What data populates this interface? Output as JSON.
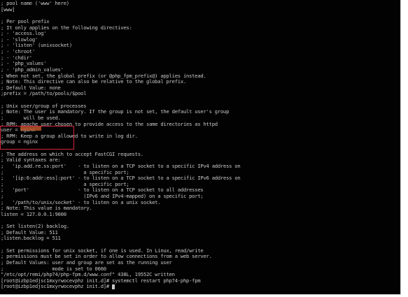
{
  "terminal": {
    "lines": [
      "; pool name ('www' here)",
      "[www]",
      "",
      "; Per pool prefix",
      "; It only applies on the following directives:",
      "; - 'access.log'",
      "; - 'slowlog'",
      "; - 'listen' (unixsocket)",
      "; - 'chroot'",
      "; - 'chdir'",
      "; - 'php_values'",
      "; - 'php_admin_values'",
      "; When not set, the global prefix (or @php_fpm_prefix@) applies instead.",
      "; Note: This directive can also be relative to the global prefix.",
      "; Default Value: none",
      ";prefix = /path/to/pools/$pool",
      "",
      "; Unix user/group of processes",
      "; Note: The user is mandatory. If the group is not set, the default user's group",
      ";       will be used.",
      "; RPM: apache user chosen to provide access to the same directories as httpd",
      "user = nginx",
      "; RPM: Keep a group allowed to write in log dir.",
      "group = nginx",
      "",
      "; The address on which to accept FastCGI requests.",
      "; Valid syntaxes are:",
      ";   'ip.add.re.ss:port'    - to listen on a TCP socket to a specific IPv4 address on",
      ";                            a specific port;",
      ";   '[ip:6:addr:ess]:port' - to listen on a TCP socket to a specific IPv6 address on",
      ";                            a specific port;",
      ";   'port'                 - to listen on a TCP socket to all addresses",
      ";                            (IPv6 and IPv4-mapped) on a specific port;",
      ";   '/path/to/unix/socket' - to listen on a unix socket.",
      "; Note: This value is mandatory.",
      "listen = 127.0.0.1:9000",
      "",
      "; Set listen(2) backlog.",
      "; Default Value: 511",
      ";listen.backlog = 511",
      "",
      "; Set permissions for unix socket, if one is used. In Linux, read/write",
      "; permissions must be set in order to allow connections from a web server.",
      "; Default Values: user and group are set as the running user",
      ";                 mode is set to 0660",
      "\"/etc/opt/remi/php74/php-fpm.d/www.conf\" 438L, 19552C written",
      "[root@izbp1edjsc1mxyrwocevphz init.d]# systemctl restart php74-php-fpm",
      "[root@izbp1edjsc1mxyrwocevphz init.d]# "
    ]
  },
  "colors": {
    "background": "#020202",
    "text": "#c7c7c7",
    "highlight_box": "#d2263a",
    "highlight_mark": "#b8562c"
  }
}
